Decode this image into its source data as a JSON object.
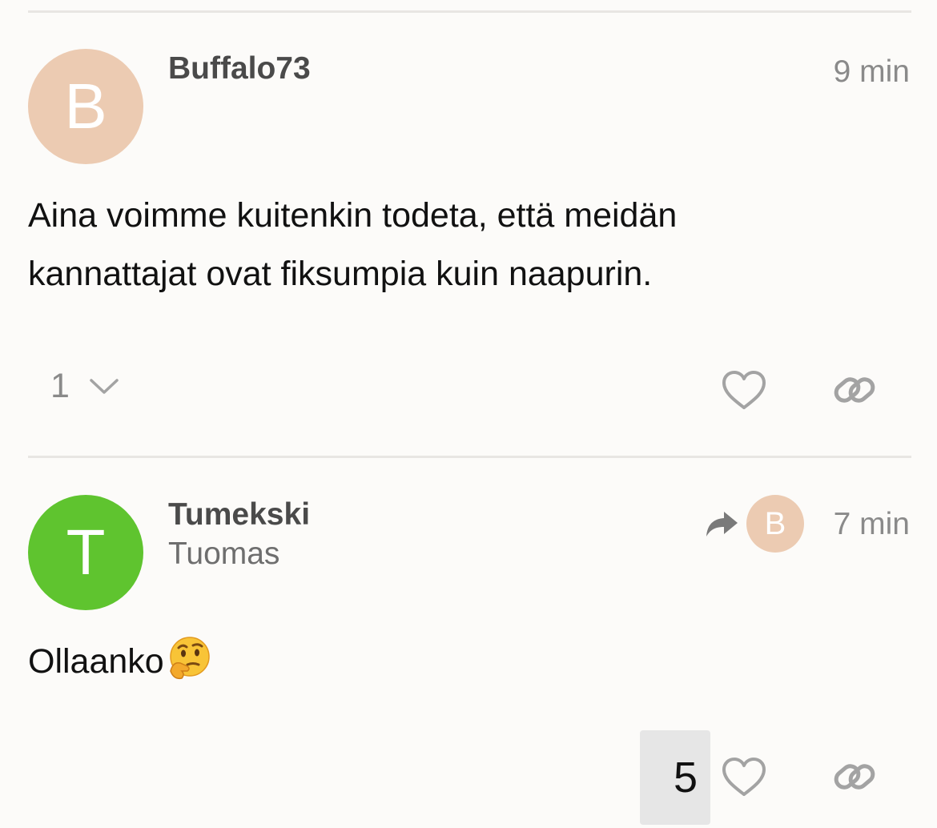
{
  "colors": {
    "avatar_b": "#eccbb2",
    "avatar_t": "#5fc42f",
    "icon_gray": "#a3a3a3",
    "divider": "#e8e6e3"
  },
  "posts": [
    {
      "avatar_letter": "B",
      "username": "Buffalo73",
      "time": "9 min",
      "body_lines": [
        "Aina voimme kuitenkin todeta, että meidän",
        "kannattajat ovat fiksumpia kuin naapurin."
      ],
      "reply_count": "1",
      "icons": [
        "chevron-down-icon",
        "heart-icon",
        "link-icon"
      ]
    },
    {
      "avatar_letter": "T",
      "username": "Tumekski",
      "full_name": "Tuomas",
      "reply_to_avatar_letter": "B",
      "time": "7 min",
      "body_text": "Ollaanko",
      "body_emoji": "thinking-face",
      "like_count": "5",
      "icons": [
        "reply-arrow-icon",
        "heart-icon",
        "link-icon"
      ]
    }
  ]
}
